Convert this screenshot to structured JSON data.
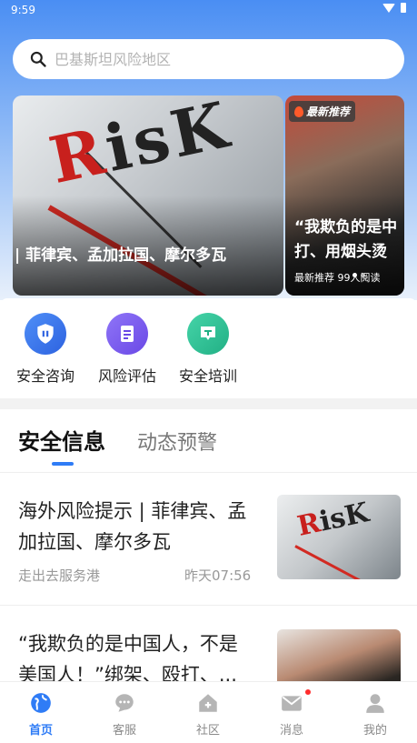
{
  "status_bar": {
    "time": "9:59"
  },
  "search": {
    "placeholder": "巴基斯坦风险地区"
  },
  "banners": [
    {
      "caption": "| 菲律宾、孟加拉国、摩尔多瓦",
      "image_text": "RisK"
    },
    {
      "badge": "最新推荐",
      "caption_line1": "“我欺负的是中",
      "caption_line2": "打、用烟头烫",
      "meta": "最新推荐 99人阅读"
    }
  ],
  "services": [
    {
      "label": "安全咨询",
      "icon": "shield-icon",
      "color": "#3b78f0"
    },
    {
      "label": "风险评估",
      "icon": "document-icon",
      "color": "#7b5cf0"
    },
    {
      "label": "安全培训",
      "icon": "chat-icon",
      "color": "#2fc39a"
    }
  ],
  "tabs": {
    "active": "安全信息",
    "inactive": "动态预警"
  },
  "news": [
    {
      "title": "海外风险提示 | 菲律宾、孟加拉国、摩尔多瓦",
      "source": "走出去服务港",
      "time": "昨天07:56",
      "thumb_text": "RisK"
    },
    {
      "title": "“我欺负的是中国人，不是美国人！”绑架、殴打、..."
    }
  ],
  "bottom_nav": [
    {
      "label": "首页",
      "icon": "globe-icon",
      "active": true
    },
    {
      "label": "客服",
      "icon": "chat-bubble-icon"
    },
    {
      "label": "社区",
      "icon": "community-icon"
    },
    {
      "label": "消息",
      "icon": "mail-icon",
      "badge": true
    },
    {
      "label": "我的",
      "icon": "person-icon"
    }
  ],
  "colors": {
    "accent": "#2f7cf6",
    "inactive": "#8a8a8a"
  }
}
